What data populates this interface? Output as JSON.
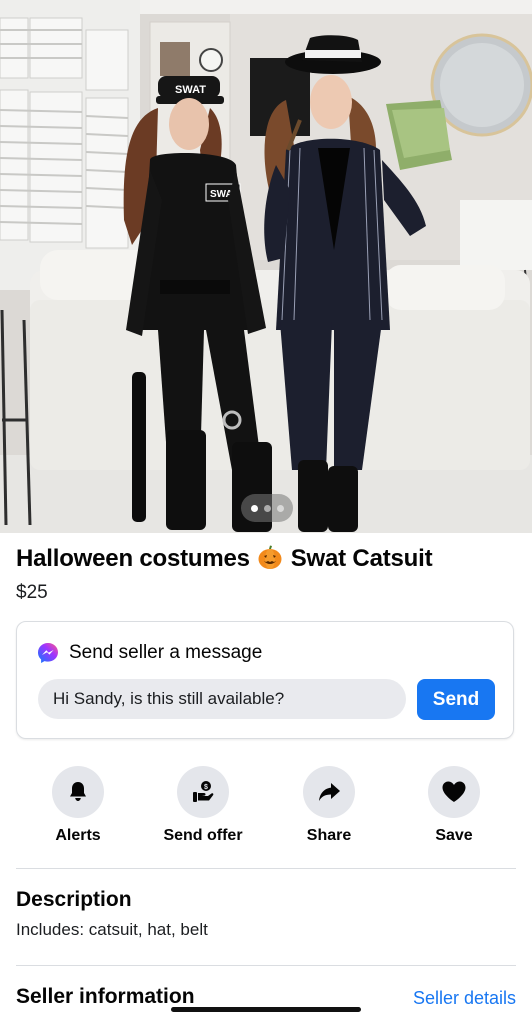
{
  "listing": {
    "title_before": "Halloween costumes",
    "title_after": "Swat Catsuit",
    "title_emoji": "pumpkin",
    "price": "$25",
    "photo_count": 3,
    "photo_index": 1
  },
  "message": {
    "header": "Send seller a message",
    "input_value": "Hi Sandy, is this still available?",
    "send_label": "Send",
    "icon": "messenger-icon"
  },
  "actions": [
    {
      "label": "Alerts",
      "icon": "bell-icon"
    },
    {
      "label": "Send offer",
      "icon": "offer-icon"
    },
    {
      "label": "Share",
      "icon": "share-arrow-icon"
    },
    {
      "label": "Save",
      "icon": "heart-icon"
    }
  ],
  "description": {
    "heading": "Description",
    "text": "Includes: catsuit, hat, belt"
  },
  "seller": {
    "heading": "Seller information",
    "link": "Seller details"
  },
  "colors": {
    "accent": "#1877f2",
    "input_bg": "#e9eaee",
    "icon_circle": "#e4e6eb"
  }
}
